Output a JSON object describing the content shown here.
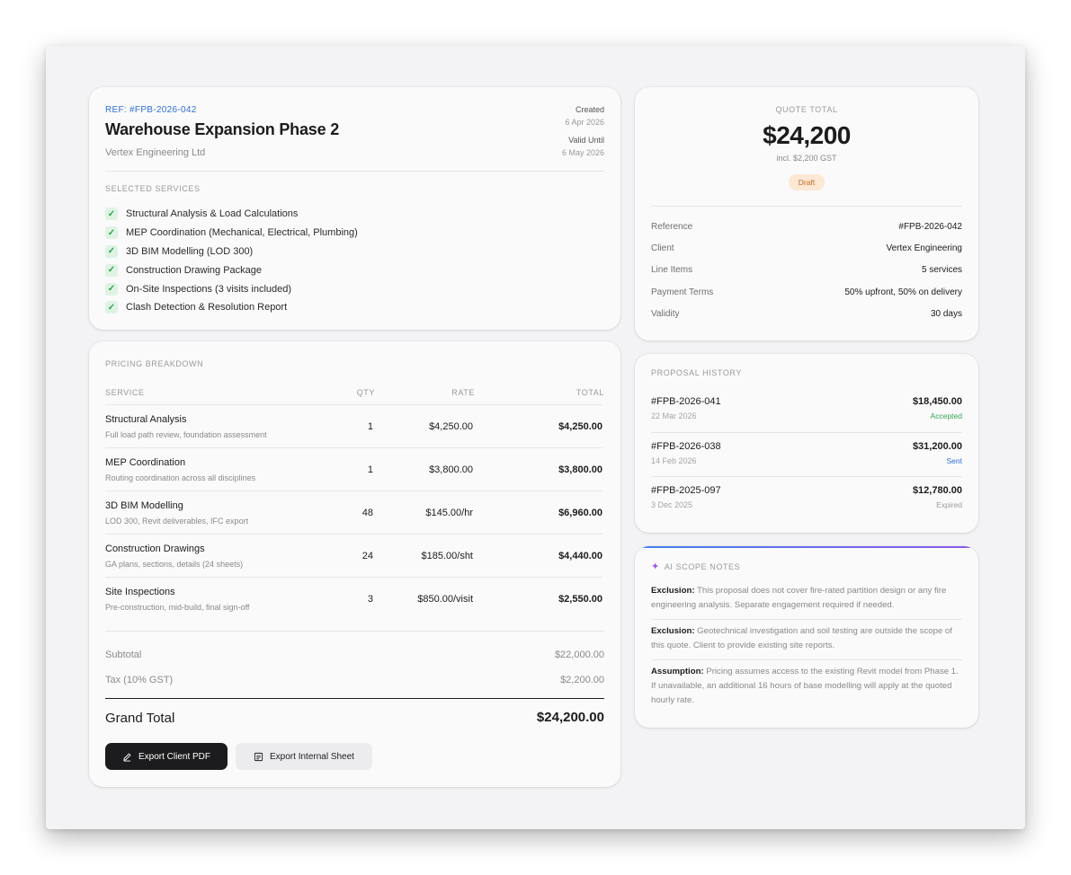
{
  "header": {
    "ref": "REF: #FPB-2026-042",
    "title": "Warehouse Expansion Phase 2",
    "client": "Vertex Engineering Ltd",
    "created_label": "Created",
    "created_value": "6 Apr 2026",
    "valid_label": "Valid Until",
    "valid_value": "6 May 2026",
    "services_label": "SELECTED SERVICES",
    "services": [
      "Structural Analysis & Load Calculations",
      "MEP Coordination (Mechanical, Electrical, Plumbing)",
      "3D BIM Modelling (LOD 300)",
      "Construction Drawing Package",
      "On-Site Inspections (3 visits included)",
      "Clash Detection & Resolution Report"
    ]
  },
  "pricing": {
    "label": "PRICING BREAKDOWN",
    "columns": {
      "service": "SERVICE",
      "qty": "QTY",
      "rate": "RATE",
      "total": "TOTAL"
    },
    "rows": [
      {
        "name": "Structural Analysis",
        "desc": "Full load path review, foundation assessment",
        "qty": "1",
        "rate": "$4,250.00",
        "total": "$4,250.00"
      },
      {
        "name": "MEP Coordination",
        "desc": "Routing coordination across all disciplines",
        "qty": "1",
        "rate": "$3,800.00",
        "total": "$3,800.00"
      },
      {
        "name": "3D BIM Modelling",
        "desc": "LOD 300, Revit deliverables, IFC export",
        "qty": "48",
        "rate": "$145.00/hr",
        "total": "$6,960.00"
      },
      {
        "name": "Construction Drawings",
        "desc": "GA plans, sections, details (24 sheets)",
        "qty": "24",
        "rate": "$185.00/sht",
        "total": "$4,440.00"
      },
      {
        "name": "Site Inspections",
        "desc": "Pre-construction, mid-build, final sign-off",
        "qty": "3",
        "rate": "$850.00/visit",
        "total": "$2,550.00"
      }
    ],
    "subtotal_label": "Subtotal",
    "subtotal_value": "$22,000.00",
    "tax_label": "Tax (10% GST)",
    "tax_value": "$2,200.00",
    "grand_label": "Grand Total",
    "grand_value": "$24,200.00",
    "export_pdf": "Export Client PDF",
    "export_sheet": "Export Internal Sheet"
  },
  "quote": {
    "label": "QUOTE TOTAL",
    "amount": "$24,200",
    "gst": "incl. $2,200 GST",
    "status": "Draft",
    "details": [
      {
        "label": "Reference",
        "value": "#FPB-2026-042"
      },
      {
        "label": "Client",
        "value": "Vertex Engineering"
      },
      {
        "label": "Line Items",
        "value": "5 services"
      },
      {
        "label": "Payment Terms",
        "value": "50% upfront, 50% on delivery"
      },
      {
        "label": "Validity",
        "value": "30 days"
      }
    ]
  },
  "history": {
    "label": "PROPOSAL HISTORY",
    "items": [
      {
        "id": "#FPB-2026-041",
        "date": "22 Mar 2026",
        "amount": "$18,450.00",
        "status": "Accepted",
        "status_color": "#34a853"
      },
      {
        "id": "#FPB-2026-038",
        "date": "14 Feb 2026",
        "amount": "$31,200.00",
        "status": "Sent",
        "status_color": "#2f6fd6"
      },
      {
        "id": "#FPB-2025-097",
        "date": "3 Dec 2025",
        "amount": "$12,780.00",
        "status": "Expired",
        "status_color": "#9a9a9e"
      }
    ]
  },
  "ai": {
    "label": "AI SCOPE NOTES",
    "notes": [
      {
        "kind": "Exclusion:",
        "text": " This proposal does not cover fire-rated partition design or any fire engineering analysis. Separate engagement required if needed."
      },
      {
        "kind": "Exclusion:",
        "text": " Geotechnical investigation and soil testing are outside the scope of this quote. Client to provide existing site reports."
      },
      {
        "kind": "Assumption:",
        "text": " Pricing assumes access to the existing Revit model from Phase 1. If unavailable, an additional 16 hours of base modelling will apply at the quoted hourly rate."
      }
    ]
  },
  "colors": {
    "accent": "#2f6fd6",
    "dark_button": "#1c1c1e",
    "draft_bg": "#fde8d4",
    "draft_fg": "#c06a1f",
    "check": "#2f9e55"
  }
}
